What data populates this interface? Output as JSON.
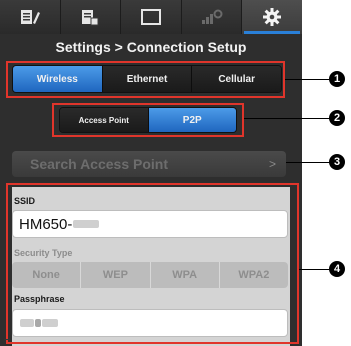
{
  "tabs": [
    {
      "icon": "edit-document-icon"
    },
    {
      "icon": "clip-info-icon"
    },
    {
      "icon": "monitor-icon"
    },
    {
      "icon": "signal-settings-icon"
    },
    {
      "icon": "gear-icon",
      "active": true
    }
  ],
  "title": "Settings > Connection Setup",
  "connection_modes": {
    "options": [
      "Wireless",
      "Ethernet",
      "Cellular"
    ],
    "selected": "Wireless"
  },
  "wireless_modes": {
    "options": [
      "Access Point",
      "P2P"
    ],
    "selected": "P2P"
  },
  "search_access_point": {
    "label": "Search Access Point",
    "chevron": ">"
  },
  "ssid": {
    "label": "SSID",
    "value": "HM650-"
  },
  "security_type": {
    "label": "Security Type",
    "options": [
      "None",
      "WEP",
      "WPA",
      "WPA2"
    ]
  },
  "passphrase": {
    "label": "Passphrase"
  },
  "callouts": [
    "1",
    "2",
    "3",
    "4"
  ],
  "colors": {
    "accent": "#2a80d8",
    "highlight": "#e0352b"
  }
}
